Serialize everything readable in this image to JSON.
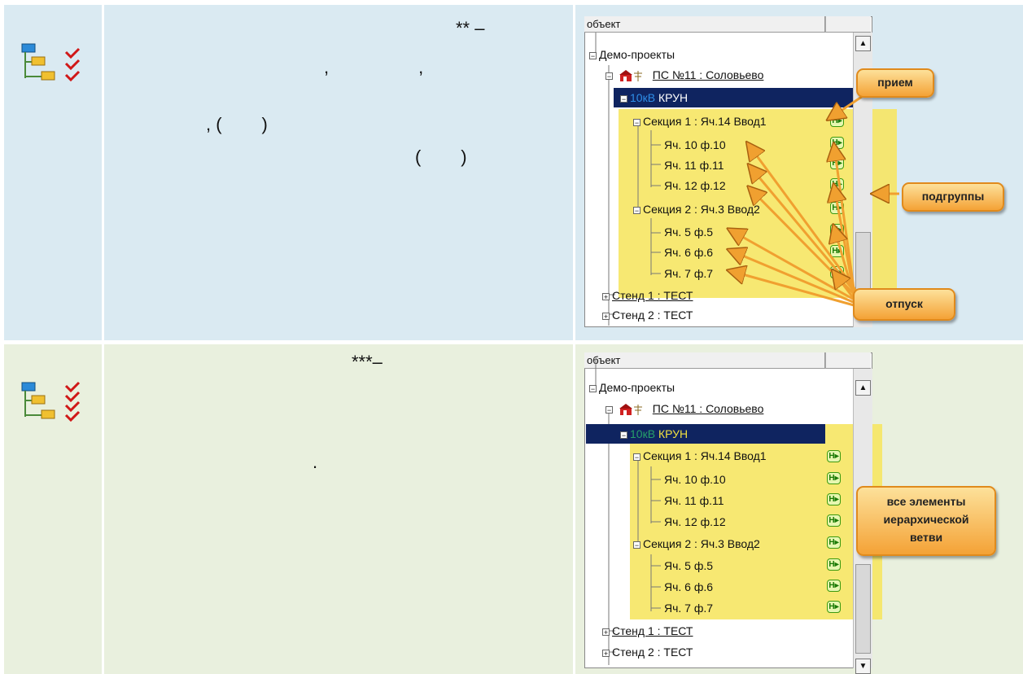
{
  "row1": {
    "text_lines": [
      "** –",
      ",                  ,",
      ", (        )",
      "(        )"
    ],
    "panel": {
      "header": "объект",
      "root": "Демо-проекты",
      "substation": "ПС №11 : Соловьево",
      "voltage": "10кВ",
      "kryn": "КРУН",
      "section1": "Секция 1 : Яч.14 Ввод1",
      "cells1": [
        "Яч. 10 ф.10",
        "Яч. 11 ф.11",
        "Яч. 12 ф.12"
      ],
      "section2": "Секция 2 : Яч.3 Ввод2",
      "cells2": [
        "Яч. 5 ф.5",
        "Яч. 6 ф.6",
        "Яч. 7 ф.7"
      ],
      "stand1": "Стенд 1 : ТЕСТ",
      "stand2": "Стенд 2 : ТЕСТ"
    },
    "callouts": {
      "priem": "прием",
      "podgruppy": "подгруппы",
      "otpusk": "отпуск"
    }
  },
  "row2": {
    "text_lines": [
      "***–",
      "."
    ],
    "panel": {
      "header": "объект",
      "root": "Демо-проекты",
      "substation": "ПС №11 : Соловьево",
      "voltage": "10кВ",
      "kryn": "КРУН",
      "section1": "Секция 1 : Яч.14 Ввод1",
      "cells1": [
        "Яч. 10 ф.10",
        "Яч. 11 ф.11",
        "Яч. 12 ф.12"
      ],
      "section2": "Секция 2 : Яч.3 Ввод2",
      "cells2": [
        "Яч. 5 ф.5",
        "Яч. 6 ф.6",
        "Яч. 7 ф.7"
      ],
      "stand1": "Стенд 1 : ТЕСТ",
      "stand2": "Стенд 2 : ТЕСТ"
    },
    "callout_lines": [
      "все элементы",
      "иерархической",
      "ветви"
    ]
  },
  "icons": {
    "row_icon": "tree-checkmarks-icon",
    "meter_icon": "meter-io-icon"
  },
  "colors": {
    "row1_bg": "#daeaf2",
    "row2_bg": "#e9f0de",
    "highlight": "#f6e563",
    "selection": "#0f2460",
    "callout": "#f4a236"
  }
}
